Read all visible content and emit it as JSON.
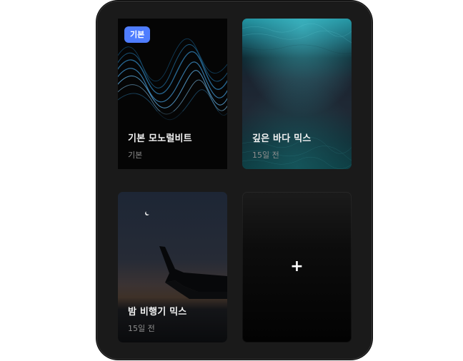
{
  "cards": [
    {
      "title": "기본 모노럴비트",
      "subtitle": "기본",
      "badge": "기본",
      "background": "waveform-image"
    },
    {
      "title": "깊은 바다 믹스",
      "subtitle": "15일 전",
      "background": "deep-ocean-image"
    },
    {
      "title": "밤 비행기 믹스",
      "subtitle": "15일 전",
      "background": "night-flight-image"
    }
  ],
  "add_card": {
    "icon": "plus-icon",
    "symbol": "+"
  },
  "colors": {
    "device_bg": "#1a1a1a",
    "badge_bg": "#4f7dff",
    "title_text": "#f2f2f2",
    "subtitle_text": "#8e8e8e",
    "ocean_teal": "#1f8e9c"
  }
}
